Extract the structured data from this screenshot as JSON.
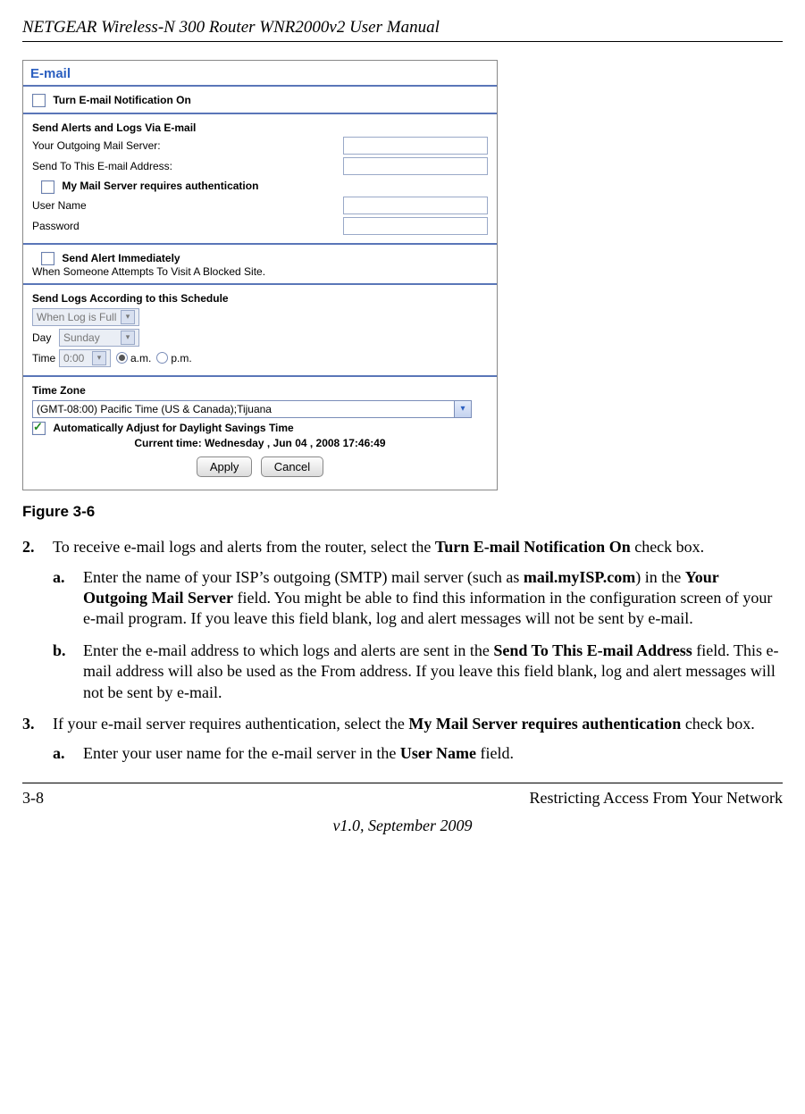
{
  "header": {
    "title": "NETGEAR Wireless-N 300 Router WNR2000v2 User Manual"
  },
  "screenshot": {
    "panel_title": "E-mail",
    "sec_notify": {
      "checkbox_label": "Turn E-mail Notification On"
    },
    "sec_send": {
      "heading": "Send Alerts and Logs Via E-mail",
      "outgoing_label": "Your Outgoing Mail Server:",
      "sendto_label": "Send To This E-mail Address:",
      "auth_checkbox_label": "My Mail Server requires authentication",
      "username_label": "User Name",
      "password_label": "Password"
    },
    "sec_alert": {
      "checkbox_label": "Send Alert Immediately",
      "desc": "When Someone Attempts To Visit A Blocked Site."
    },
    "sec_schedule": {
      "heading": "Send Logs According to this Schedule",
      "schedule_value": "When Log is Full",
      "day_label": "Day",
      "day_value": "Sunday",
      "time_label": "Time",
      "time_value": "0:00",
      "am_label": "a.m.",
      "pm_label": "p.m."
    },
    "sec_tz": {
      "heading": "Time Zone",
      "tz_value": "(GMT-08:00) Pacific Time (US & Canada);Tijuana",
      "dst_label": "Automatically Adjust for Daylight Savings Time",
      "current_time": "Current time: Wednesday , Jun 04 , 2008 17:46:49"
    },
    "buttons": {
      "apply": "Apply",
      "cancel": "Cancel"
    }
  },
  "figure_caption": "Figure 3-6",
  "steps": {
    "s2": {
      "num": "2.",
      "text_a": "To receive e-mail logs and alerts from the router, select the ",
      "text_bold": "Turn E-mail Notification On",
      "text_b": " check box.",
      "a": {
        "lett": "a.",
        "t1": "Enter the name of your ISP’s outgoing (SMTP) mail server (such as ",
        "b1": "mail.myISP.com",
        "t2": ") in the ",
        "b2": "Your Outgoing Mail Server",
        "t3": " field. You might be able to find this information in the configuration screen of your e-mail program. If you leave this field blank, log and alert messages will not be sent by e-mail."
      },
      "b": {
        "lett": "b.",
        "t1": "Enter the e-mail address to which logs and alerts are sent in the ",
        "b1": "Send To This E-mail Address",
        "t2": " field. This e-mail address will also be used as the From address. If you leave this field blank, log and alert messages will not be sent by e-mail."
      }
    },
    "s3": {
      "num": "3.",
      "t1": "If your e-mail server requires authentication, select the ",
      "b1": "My Mail Server requires authentication",
      "t2": " check box.",
      "a": {
        "lett": "a.",
        "t1": "Enter your user name for the e-mail server in the ",
        "b1": "User Name",
        "t2": " field."
      }
    }
  },
  "footer": {
    "page": "3-8",
    "section": "Restricting Access From Your Network",
    "version": "v1.0, September 2009"
  }
}
